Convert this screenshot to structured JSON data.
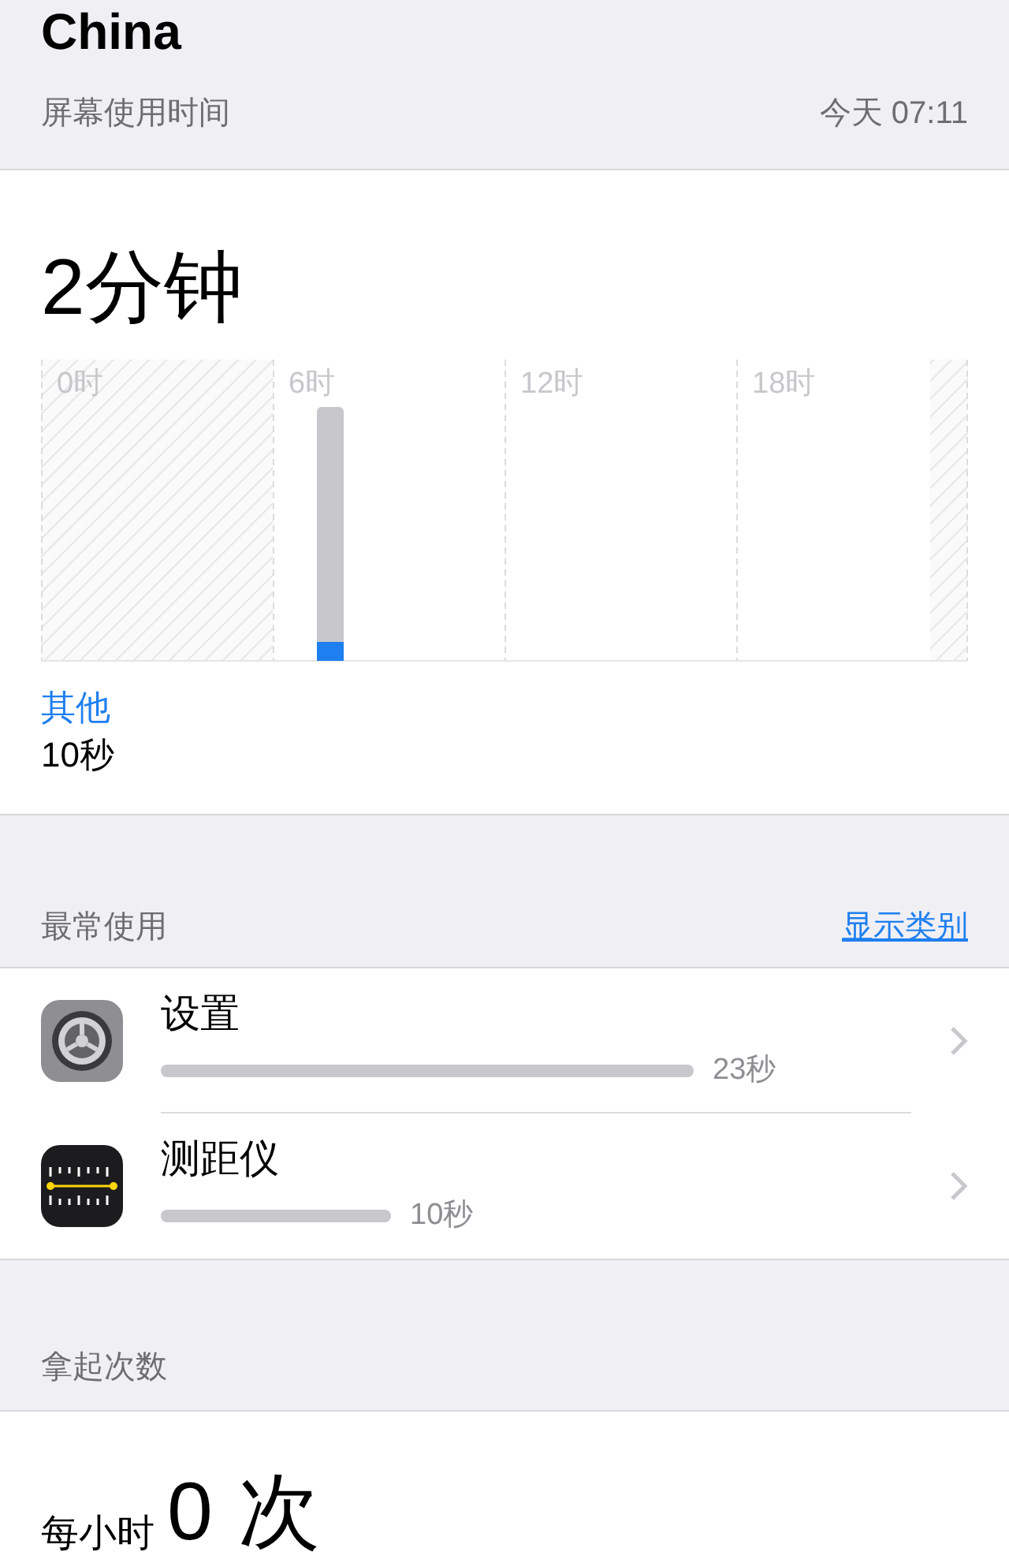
{
  "title": "China",
  "screen_time": {
    "label": "屏幕使用时间",
    "date": "今天 07:11"
  },
  "total": "2分钟",
  "chart": {
    "hour_labels": [
      "0时",
      "6时",
      "12时",
      "18时"
    ]
  },
  "legend": {
    "category": "其他",
    "duration": "10秒"
  },
  "most_used": {
    "label": "最常使用",
    "link": "显示类别"
  },
  "apps": [
    {
      "kind": "settings",
      "name": "设置",
      "duration": "23秒"
    },
    {
      "kind": "measure",
      "name": "测距仪",
      "duration": "10秒"
    }
  ],
  "pickups": {
    "label": "拿起次数",
    "prefix": "每小时",
    "count": "0",
    "unit": "次"
  }
}
